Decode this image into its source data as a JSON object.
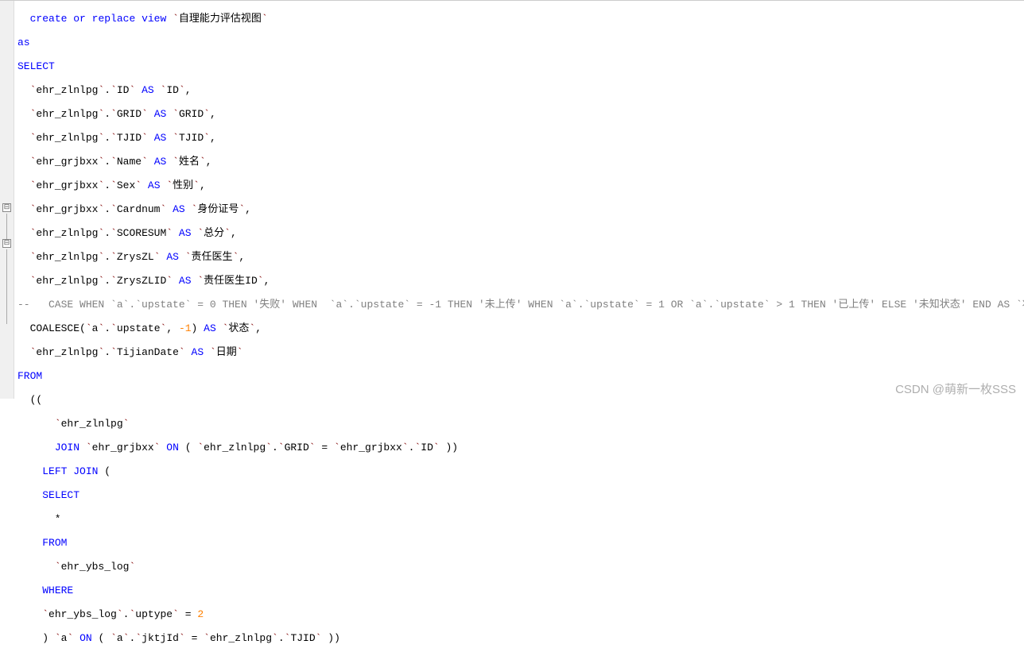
{
  "watermark": "CSDN @萌新一枚SSS",
  "kw": {
    "create": "create",
    "or": "or",
    "replace": "replace",
    "view": "view",
    "as": "as",
    "SELECT": "SELECT",
    "AS": "AS",
    "FROM": "FROM",
    "JOIN": "JOIN",
    "ON": "ON",
    "LEFT": "LEFT",
    "WHERE": "WHERE"
  },
  "fn": {
    "COALESCE": "COALESCE"
  },
  "num": {
    "neg1": "-1",
    "two": "2"
  },
  "tbl": {
    "view_name": "自理能力评估视图",
    "zlnlpg": "ehr_zlnlpg",
    "grjbxx": "ehr_grjbxx",
    "ybs_log": "ehr_ybs_log",
    "a": "a"
  },
  "col": {
    "ID": "ID",
    "GRID": "GRID",
    "TJID": "TJID",
    "Name": "Name",
    "Sex": "Sex",
    "Cardnum": "Cardnum",
    "SCORESUM": "SCORESUM",
    "ZrysZL": "ZrysZL",
    "ZrysZLID": "ZrysZLID",
    "upstate": "upstate",
    "TijianDate": "TijianDate",
    "uptype": "uptype",
    "jktjId": "jktjId"
  },
  "alias": {
    "ID": "ID",
    "GRID": "GRID",
    "TJID": "TJID",
    "name": "姓名",
    "sex": "性别",
    "cardnum": "身份证号",
    "scoresum": "总分",
    "zryszl": "责任医生",
    "zryszlid": "责任医生ID",
    "status": "状态",
    "date": "日期"
  },
  "comment": {
    "case_line": "--   CASE WHEN `a`.`upstate` = 0 THEN '失败' WHEN  `a`.`upstate` = -1 THEN '未上传' WHEN `a`.`upstate` = 1 OR `a`.`upstate` > 1 THEN '已上传' ELSE '未知状态' END AS `状态`,"
  },
  "fold_glyph": "⊟"
}
